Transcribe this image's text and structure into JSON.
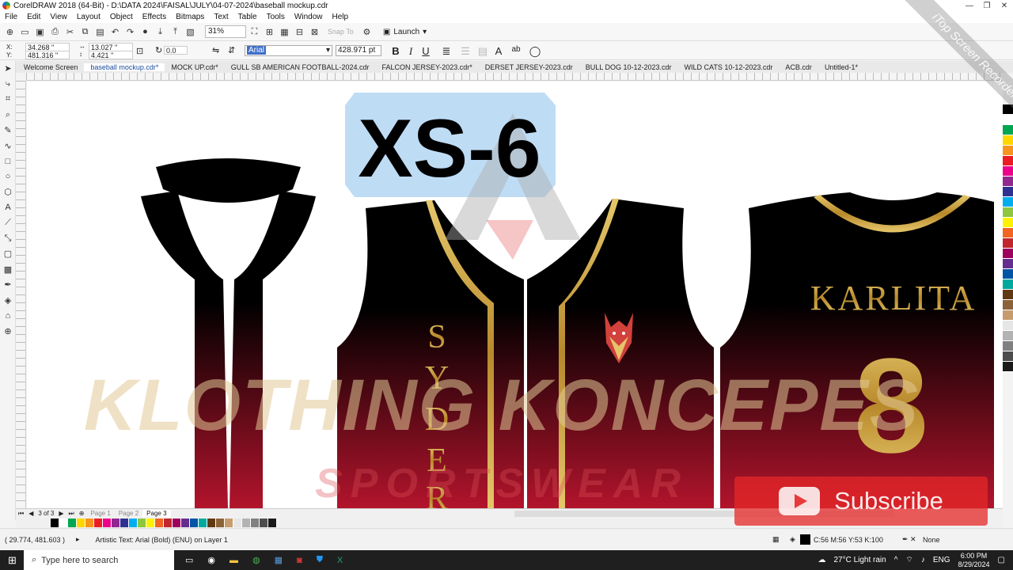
{
  "window": {
    "title": "CorelDRAW 2018 (64-Bit) - D:\\DATA 2024\\FAISAL\\JULY\\04-07-2024\\baseball mockup.cdr",
    "controls": [
      "—",
      "❐",
      "✕"
    ]
  },
  "menu": [
    "File",
    "Edit",
    "View",
    "Layout",
    "Object",
    "Effects",
    "Bitmaps",
    "Text",
    "Table",
    "Tools",
    "Window",
    "Help"
  ],
  "toolbar": {
    "zoom": "31%",
    "snap_label": "Snap To",
    "launch_label": "Launch"
  },
  "property_bar": {
    "x": "34.268 \"",
    "y": "481.316 \"",
    "width": "13.027 \"",
    "height": "4.421 \"",
    "angle": "0.0",
    "font": "Arial",
    "font_size": "428.971 pt",
    "bold": "B",
    "italic": "I",
    "underline": "U"
  },
  "tabs": [
    "Welcome Screen",
    "baseball mockup.cdr*",
    "MOCK UP.cdr*",
    "GULL SB AMERICAN FOOTBALL-2024.cdr",
    "FALCON JERSEY-2023.cdr*",
    "DERSET JERSEY-2023.cdr",
    "BULL DOG 10-12-2023.cdr",
    "WILD CATS 10-12-2023.cdr",
    "ACB.cdr",
    "Untitled-1*"
  ],
  "active_tab_index": 1,
  "canvas": {
    "size_label": "XS-6",
    "front_name": [
      "S",
      "Y",
      "D",
      "E",
      "R"
    ],
    "back_name": "KARLITA",
    "back_number": "8",
    "watermark_main": "KLOTHING KONCEPES",
    "watermark_sub": "SPORTSWEAR"
  },
  "page_nav": {
    "counter": "3 of 3",
    "pages": [
      "Page 1",
      "Page 2",
      "Page 3"
    ],
    "current": "Page 3"
  },
  "status": {
    "coords": "( 29.774, 481.603 )",
    "object_info": "Artistic Text: Arial (Bold) (ENU) on Layer 1",
    "fill_info": "C:56 M:56 Y:53 K:100",
    "outline_info": "None"
  },
  "overlay": {
    "subscribe_label": "Subscribe",
    "recorder_label": "iTop Screen Recorder"
  },
  "taskbar": {
    "search_placeholder": "Type here to search",
    "weather": "27°C  Light rain",
    "lang": "ENG",
    "time": "6:00 PM",
    "date": "8/29/2024"
  },
  "colors": {
    "jersey_top": "#000000",
    "jersey_bottom": "#b3142c",
    "gold": "#c9a23c",
    "selection": "#bfdcf5"
  },
  "palette_colors": [
    "#000000",
    "#ffffff",
    "#00a650",
    "#ffd700",
    "#f7941d",
    "#ed1c24",
    "#ec008c",
    "#92278f",
    "#2e3192",
    "#00aeef",
    "#8dc63f",
    "#fff200",
    "#f26522",
    "#c1272d",
    "#9e005d",
    "#662d91",
    "#0054a6",
    "#00a99d",
    "#603913",
    "#8c6239",
    "#c69c6d",
    "#e6e6e6",
    "#b3b3b3",
    "#808080",
    "#4d4d4d",
    "#1a1a1a"
  ]
}
